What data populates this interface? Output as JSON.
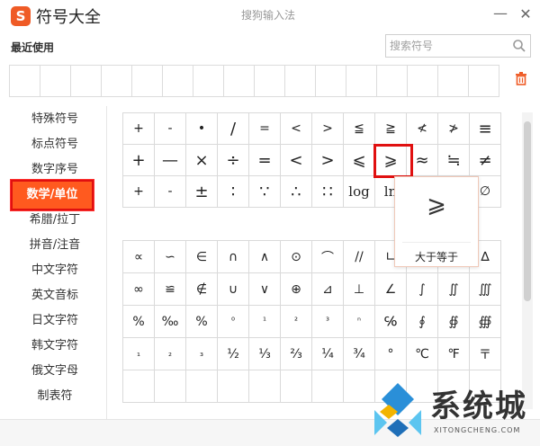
{
  "titlebar": {
    "logo_char": "S",
    "app_title": "符号大全",
    "window_title": "搜狗输入法",
    "minimize": "—",
    "close": "✕"
  },
  "recent": {
    "label": "最近使用",
    "search_placeholder": "搜索符号"
  },
  "sidebar": {
    "items": [
      {
        "label": "特殊符号"
      },
      {
        "label": "标点符号"
      },
      {
        "label": "数字序号"
      },
      {
        "label": "数学/单位"
      },
      {
        "label": "希腊/拉丁"
      },
      {
        "label": "拼音/注音"
      },
      {
        "label": "中文字符"
      },
      {
        "label": "英文音标"
      },
      {
        "label": "日文字符"
      },
      {
        "label": "韩文字符"
      },
      {
        "label": "俄文字母"
      },
      {
        "label": "制表符"
      }
    ],
    "active_index": 3
  },
  "grid1": [
    [
      "+",
      "-",
      "•",
      "/",
      "=",
      "<",
      ">",
      "≦",
      "≧",
      "≮",
      "≯",
      "≡"
    ],
    [
      "+",
      "—",
      "×",
      "÷",
      "=",
      "<",
      ">",
      "⩽",
      "⩾",
      "≈",
      "≒",
      "≠"
    ],
    [
      "+",
      "-",
      "±",
      "∶",
      "∵",
      "∴",
      "∷",
      "log",
      "ln",
      "",
      "",
      "∅"
    ]
  ],
  "grid2": [
    [
      "∝",
      "∽",
      "∈",
      "∩",
      "∧",
      "⊙",
      "⌒",
      "//",
      "∟",
      "",
      "",
      "∆"
    ],
    [
      "∞",
      "≌",
      "∉",
      "∪",
      "∨",
      "⊕",
      "⊿",
      "⊥",
      "∠",
      "∫",
      "∬",
      "∭"
    ],
    [
      "%",
      "‰",
      "%",
      "⁰",
      "¹",
      "²",
      "³",
      "ⁿ",
      "℅",
      "∮",
      "∯",
      "∰"
    ],
    [
      "₁",
      "₂",
      "₃",
      "½",
      "⅓",
      "⅔",
      "¼",
      "¾",
      "°",
      "℃",
      "℉",
      "〒"
    ]
  ],
  "tooltip": {
    "symbol": "⩾",
    "name": "大于等于"
  },
  "watermark": {
    "text": "系统城",
    "sub": "XITONGCHENG.COM"
  },
  "colors": {
    "accent": "#ff5a1f",
    "highlight": "#e01010"
  }
}
